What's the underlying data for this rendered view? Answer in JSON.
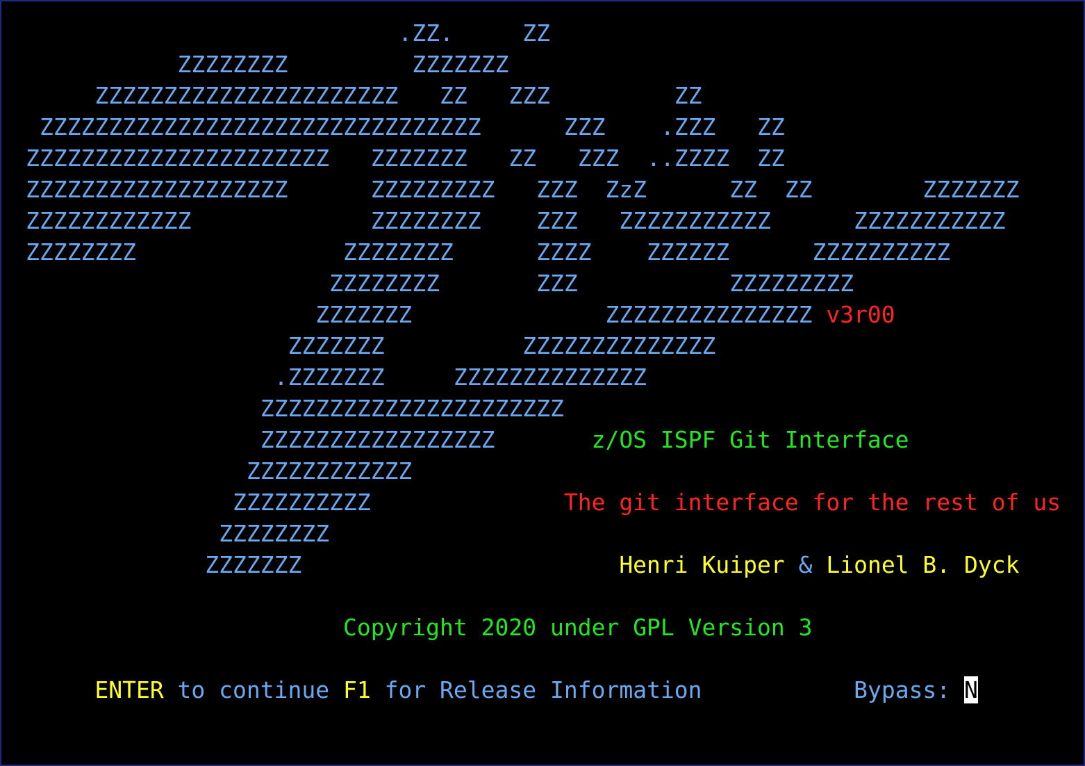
{
  "logo_art": [
    "                           .ZZ.     ZZ",
    "           ZZZZZZZZ         ZZZZZZZ",
    "     ZZZZZZZZZZZZZZZZZZZZZZ   ZZ   ZZZ         ZZ",
    " ZZZZZZZZZZZZZZZZZZZZZZZZZZZZZZZZ      ZZZ    .ZZZ   ZZ",
    "ZZZZZZZZZZZZZZZZZZZZZZ   ZZZZZZZ   ZZ   ZZZ  ..ZZZZ  ZZ",
    "ZZZZZZZZZZZZZZZZZZZ      ZZZZZZZZZ   ZZZ  ZzZ      ZZ  ZZ        ZZZZZZZ",
    "ZZZZZZZZZZZZ             ZZZZZZZZ    ZZZ   ZZZZZZZZZZZ      ZZZZZZZZZZZ",
    "ZZZZZZZZ               ZZZZZZZZ      ZZZZ    ZZZZZZ      ZZZZZZZZZZ",
    "                      ZZZZZZZZ       ZZZ           ZZZZZZZZZ",
    "                     ZZZZZZZ              ZZZZZZZZZZZZZZZ",
    "                   ZZZZZZZ          ZZZZZZZZZZZZZZ",
    "                  .ZZZZZZZ     ZZZZZZZZZZZZZZ",
    "                 ZZZZZZZZZZZZZZZZZZZZZZ",
    "                 ZZZZZZZZZZZZZZZZZ",
    "                ZZZZZZZZZZZZ",
    "               ZZZZZZZZZZ",
    "              ZZZZZZZZ",
    "             ZZZZZZZ"
  ],
  "version_indent": "                                                          ",
  "version": "v3r00",
  "product_indent": "                                         ",
  "product_name": "z/OS ISPF Git Interface",
  "tagline_indent": "                                       ",
  "tagline": "The git interface for the rest of us",
  "authors_indent": "                                           ",
  "author_1": "Henri Kuiper",
  "author_separator": " & ",
  "author_2": "Lionel B. Dyck",
  "copyright_indent": "                       ",
  "copyright": "Copyright 2020 under GPL Version 3",
  "footer_indent": "     ",
  "footer_enter_key": "ENTER",
  "footer_enter_text": " to continue ",
  "footer_f1_key": "F1",
  "footer_f1_text": " for Release Information",
  "footer_gap": "           ",
  "bypass_label": "Bypass: ",
  "bypass_value": "N",
  "colors": {
    "background": "#000000",
    "border": "#1c2a86",
    "art": "#6aa8f0",
    "version": "#ff2424",
    "product_name": "#22e822",
    "tagline": "#ff2424",
    "authors": "#ffff2a",
    "copyright": "#22e822",
    "key_highlight": "#ffff2a",
    "footer_text": "#6aa8f0"
  }
}
